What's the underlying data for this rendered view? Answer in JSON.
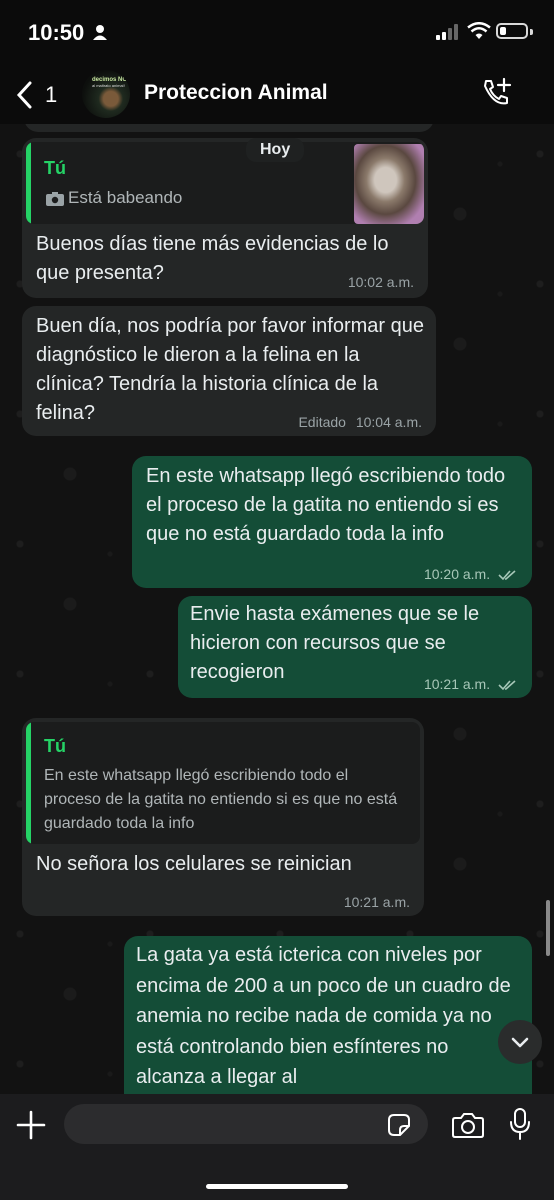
{
  "status_bar": {
    "time": "10:50"
  },
  "header": {
    "back_count": "1",
    "contact_name": "Proteccion Animal",
    "avatar_text_top": "decimos NO",
    "avatar_text_sub": "al maltrato animal!"
  },
  "chat": {
    "day_label": "Hoy",
    "messages": [
      {
        "quote_author": "Tú",
        "quote_text": "Está babeando",
        "text": "Buenos días tiene más evidencias de lo que presenta?",
        "time": "10:02 a.m."
      },
      {
        "text": "Buen día, nos podría por favor informar que diagnóstico le dieron a la felina en la clínica? Tendría la historia clínica de la felina?",
        "edited": "Editado",
        "time": "10:04 a.m."
      },
      {
        "text": "En este whatsapp llegó escribiendo todo el proceso de la gatita no entiendo si es que no está guardado toda la info",
        "time": "10:20 a.m."
      },
      {
        "text": "Envie hasta exámenes que se le hicieron con recursos que se recogieron",
        "time": "10:21 a.m."
      },
      {
        "quote_author": "Tú",
        "quote_text": "En este whatsapp llegó escribiendo todo el proceso de la gatita no entiendo si es que no está guardado toda la info",
        "text": "No señora los celulares se reinician",
        "time": "10:21 a.m."
      },
      {
        "text": "La gata ya está icterica con niveles por encima de 200 a un poco de un cuadro de anemia no recibe nada de comida ya no está controlando bien esfínteres no alcanza a llegar al"
      }
    ]
  },
  "composer": {
    "input_value": ""
  },
  "colors": {
    "incoming": "#242626",
    "outgoing": "#144d37",
    "accent": "#25d366",
    "background": "#0b0b0b"
  },
  "icons": [
    "person-icon",
    "signal-icon",
    "wifi-icon",
    "battery-icon",
    "back-chevron-icon",
    "add-call-icon",
    "camera-icon",
    "double-check-icon",
    "chevron-down-icon",
    "plus-icon",
    "sticker-icon",
    "microphone-icon"
  ]
}
